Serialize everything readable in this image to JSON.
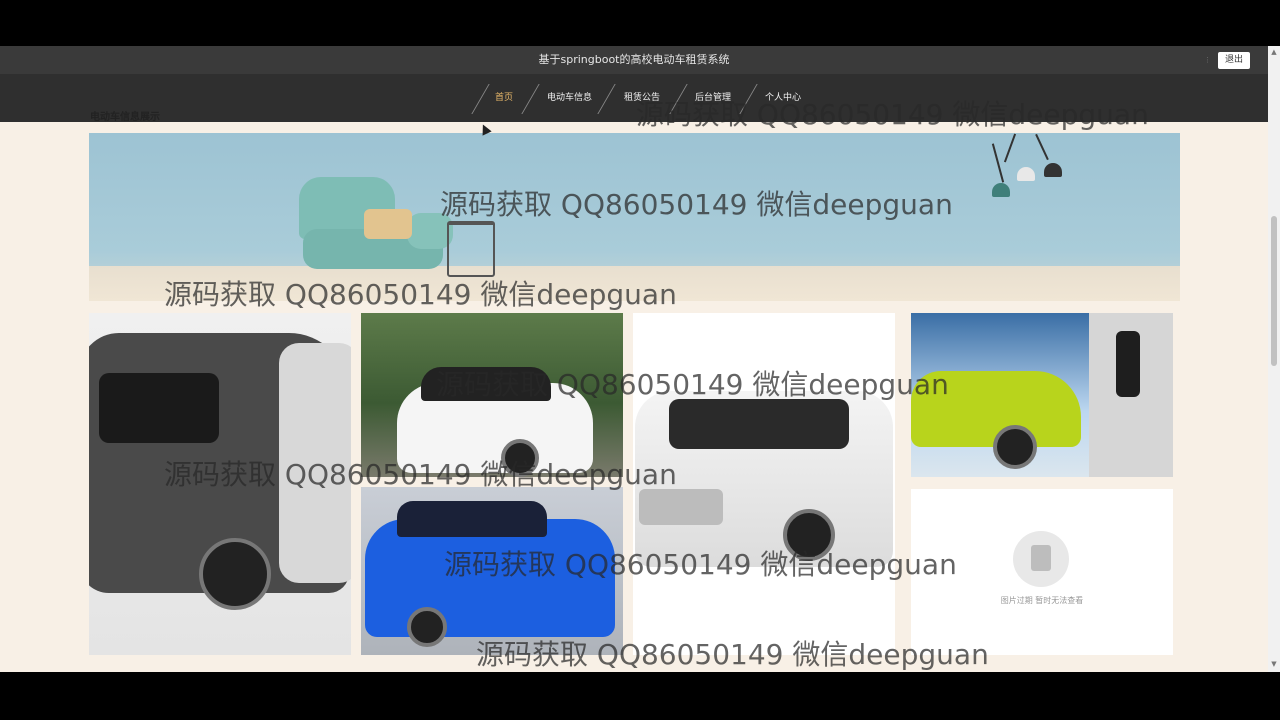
{
  "header": {
    "title": "基于springboot的高校电动车租赁系统",
    "logout_label": "退出"
  },
  "nav": {
    "items": [
      {
        "label": "首页",
        "active": true
      },
      {
        "label": "电动车信息",
        "active": false
      },
      {
        "label": "租赁公告",
        "active": false
      },
      {
        "label": "后台管理",
        "active": false
      },
      {
        "label": "个人中心",
        "active": false
      }
    ]
  },
  "section": {
    "label": "电动车信息展示"
  },
  "gallery": {
    "placeholder_text": "图片过期 暂时无法查看",
    "cards": [
      {
        "icon": "gray-minicar-image"
      },
      {
        "icon": "white-minicar-image"
      },
      {
        "icon": "white-boxcar-image"
      },
      {
        "icon": "green-suv-charging-image"
      },
      {
        "icon": "blue-minicar-image"
      },
      {
        "icon": "image-expired-placeholder"
      }
    ]
  },
  "watermark": {
    "text": "源码获取 QQ86050149 微信deepguan"
  },
  "colors": {
    "page_bg": "#f8f0e6",
    "nav_bg": "#2f2f2f",
    "active_nav": "#e8b86a"
  }
}
